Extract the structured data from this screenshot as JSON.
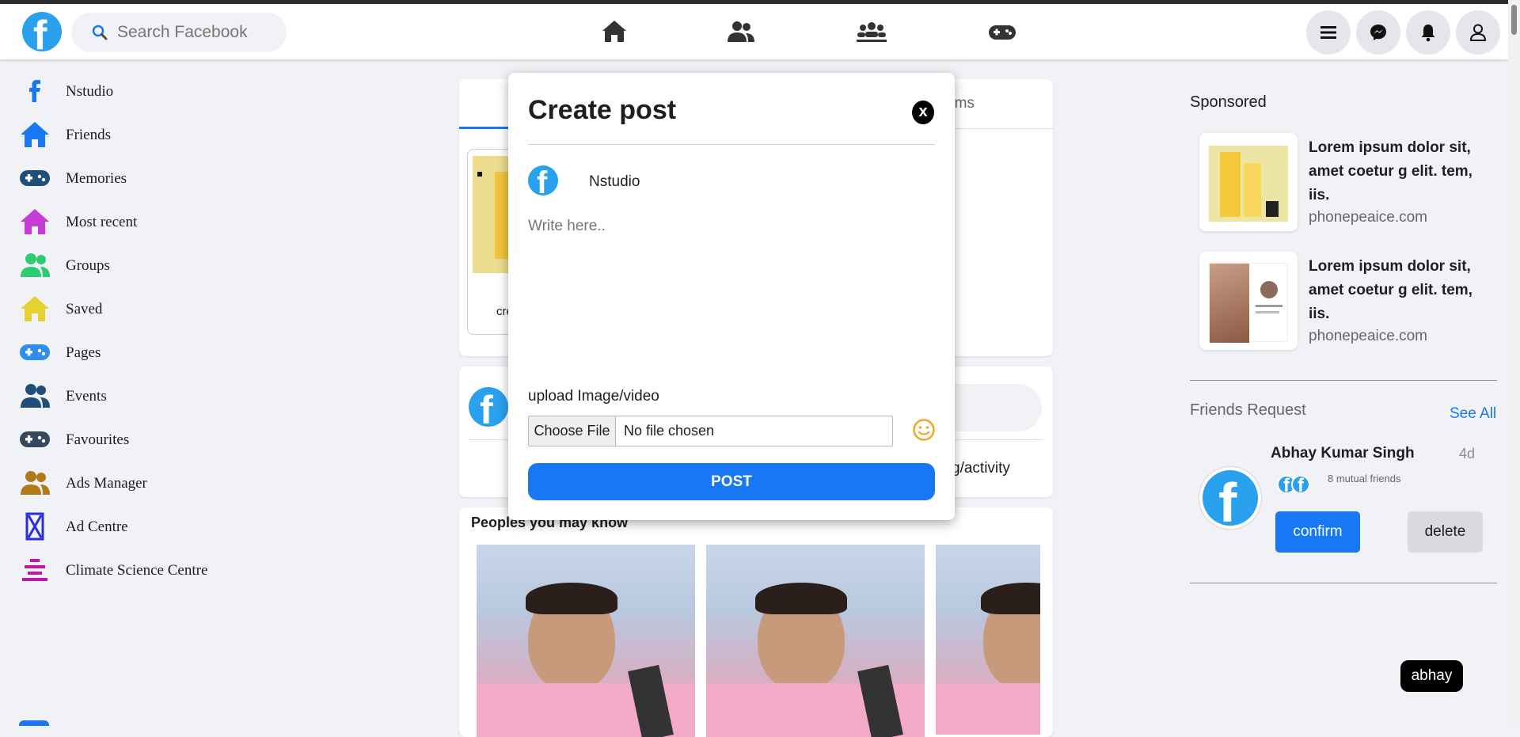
{
  "app": {
    "name": "Facebook"
  },
  "search": {
    "placeholder": "Search Facebook"
  },
  "topnav": {
    "center_icons": [
      "home-icon",
      "friends-icon",
      "groups-icon",
      "gaming-icon"
    ],
    "right_icons": [
      "menu-icon",
      "messenger-icon",
      "bell-icon",
      "profile-icon"
    ]
  },
  "sidebar": {
    "items": [
      {
        "label": "Nstudio",
        "icon": "facebook-f-icon",
        "color": "#1877f2"
      },
      {
        "label": "Friends",
        "icon": "home-icon",
        "color": "#1877f2"
      },
      {
        "label": "Memories",
        "icon": "gamepad-icon",
        "color": "#1f4e79"
      },
      {
        "label": "Most recent",
        "icon": "home-icon",
        "color": "#c73bd6"
      },
      {
        "label": "Groups",
        "icon": "users-icon",
        "color": "#2ecc71"
      },
      {
        "label": "Saved",
        "icon": "home-icon",
        "color": "#e6d22e"
      },
      {
        "label": "Pages",
        "icon": "gamepad-icon",
        "color": "#2d8ef0"
      },
      {
        "label": "Events",
        "icon": "users-icon",
        "color": "#1f4e79"
      },
      {
        "label": "Favourites",
        "icon": "gamepad-icon",
        "color": "#34495e"
      },
      {
        "label": "Ads Manager",
        "icon": "users-icon",
        "color": "#b07a1a"
      },
      {
        "label": "Ad Centre",
        "icon": "hourglass-icon",
        "color": "#2b2ee0"
      },
      {
        "label": "Climate Science Centre",
        "icon": "stack-icon",
        "color": "#c018a8"
      }
    ]
  },
  "feed": {
    "tab_partial": "oms",
    "story_caption_partial": "cre",
    "composer_partial": "g/activity",
    "people_title": "Peoples you may know"
  },
  "modal": {
    "title": "Create post",
    "close_label": "x",
    "user_name": "Nstudio",
    "text_placeholder": "Write here..",
    "upload_label": "upload Image/video",
    "choose_file": "Choose File",
    "no_file": "No file chosen",
    "post_button": "POST"
  },
  "sponsored": {
    "title": "Sponsored",
    "ads": [
      {
        "text": "Lorem ipsum dolor sit, amet coetur g elit. tem, iis.",
        "domain": "phonepeaice.com"
      },
      {
        "text": "Lorem ipsum dolor sit, amet coetur g elit. tem, iis.",
        "domain": "phonepeaice.com"
      }
    ]
  },
  "friend_requests": {
    "title": "Friends Request",
    "see_all": "See All",
    "request": {
      "name": "Abhay Kumar Singh",
      "time": "4d",
      "mutual": "8 mutual friends",
      "confirm": "confirm",
      "delete": "delete"
    }
  },
  "tooltip": {
    "text": "abhay"
  },
  "colors": {
    "brand": "#1877f2",
    "logo": "#2aa1ef",
    "confirm": "#1877f2",
    "emoji": "#f5a623"
  }
}
